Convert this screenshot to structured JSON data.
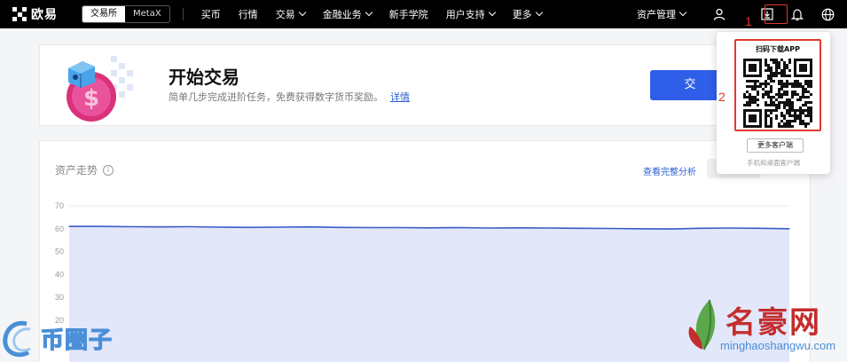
{
  "nav": {
    "brand": "欧易",
    "segment": [
      "交易所",
      "MetaX"
    ],
    "menu": [
      {
        "label": "买币",
        "caret": false
      },
      {
        "label": "行情",
        "caret": false
      },
      {
        "label": "交易",
        "caret": true
      },
      {
        "label": "金融业务",
        "caret": true
      },
      {
        "label": "新手学院",
        "caret": false
      },
      {
        "label": "用户支持",
        "caret": true
      },
      {
        "label": "更多",
        "caret": true
      }
    ],
    "asset_label": "资产管理",
    "icons": [
      "user-icon",
      "download-icon",
      "bell-icon",
      "globe-icon"
    ]
  },
  "annotations": [
    "1",
    "2"
  ],
  "banner": {
    "title": "开始交易",
    "subtitle": "简单几步完成进阶任务，免费获得数字货币奖励。",
    "link": "详情",
    "button_label": "交"
  },
  "trend": {
    "title": "资产走势",
    "analysis_link": "查看完整分析"
  },
  "qr_popup": {
    "title": "扫码下载APP",
    "more_button": "更多客户端",
    "subtitle": "手机和桌面客户端"
  },
  "watermarks": {
    "left": "币圈子",
    "right": "名豪网",
    "right_url": "minghaoshangwu.com"
  },
  "colors": {
    "nav_bg": "#000000",
    "accent_blue": "#2f5fe8",
    "annotation_red": "#e03a2f",
    "line": "#3a5cc4",
    "area_fill": "#dfe4f9"
  },
  "chart_data": {
    "type": "area",
    "title": "资产走势",
    "y_ticks": [
      70,
      60,
      50,
      40,
      30,
      20
    ],
    "ylim": [
      15,
      70
    ],
    "grid": true,
    "legend": "none",
    "x": [
      0,
      1,
      2,
      3,
      4,
      5,
      6,
      7,
      8,
      9,
      10,
      11,
      12,
      13,
      14,
      15,
      16,
      17,
      18,
      19,
      20,
      21,
      22,
      23,
      24
    ],
    "values": [
      61,
      61,
      60.9,
      60.8,
      60.9,
      60.7,
      60.6,
      60.7,
      60.8,
      60.6,
      60.5,
      60.5,
      60.4,
      60.5,
      60.3,
      60.4,
      60.3,
      60.2,
      60.1,
      60.0,
      59.9,
      60.2,
      60.3,
      60.2,
      60.0
    ]
  }
}
